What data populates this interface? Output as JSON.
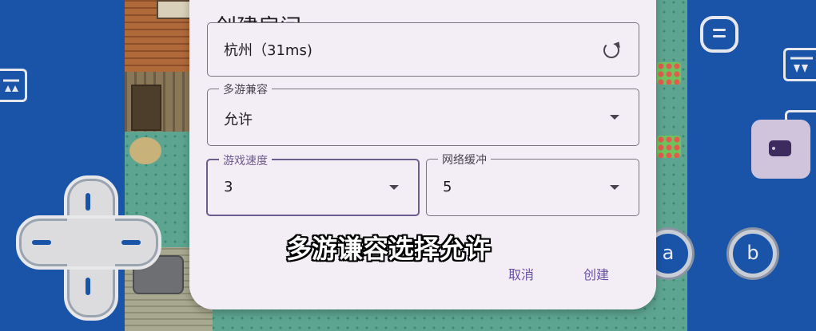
{
  "dialog": {
    "title": "创建房间",
    "server": {
      "value": "杭州（31ms)"
    },
    "multi_game_compat": {
      "label": "多游兼容",
      "value": "允许"
    },
    "game_speed": {
      "label": "游戏速度",
      "value": "3"
    },
    "net_buffer": {
      "label": "网络缓冲",
      "value": "5"
    },
    "actions": {
      "cancel": "取消",
      "create": "创建"
    }
  },
  "controls": {
    "a_label": "a",
    "b_label": "b"
  },
  "subtitle": "多游谦容选择允许",
  "colors": {
    "side_panel": "#1a54a8",
    "dialog_bg": "#f3eef6",
    "accent": "#6750a4",
    "focused_outline": "#6b5c8f"
  }
}
